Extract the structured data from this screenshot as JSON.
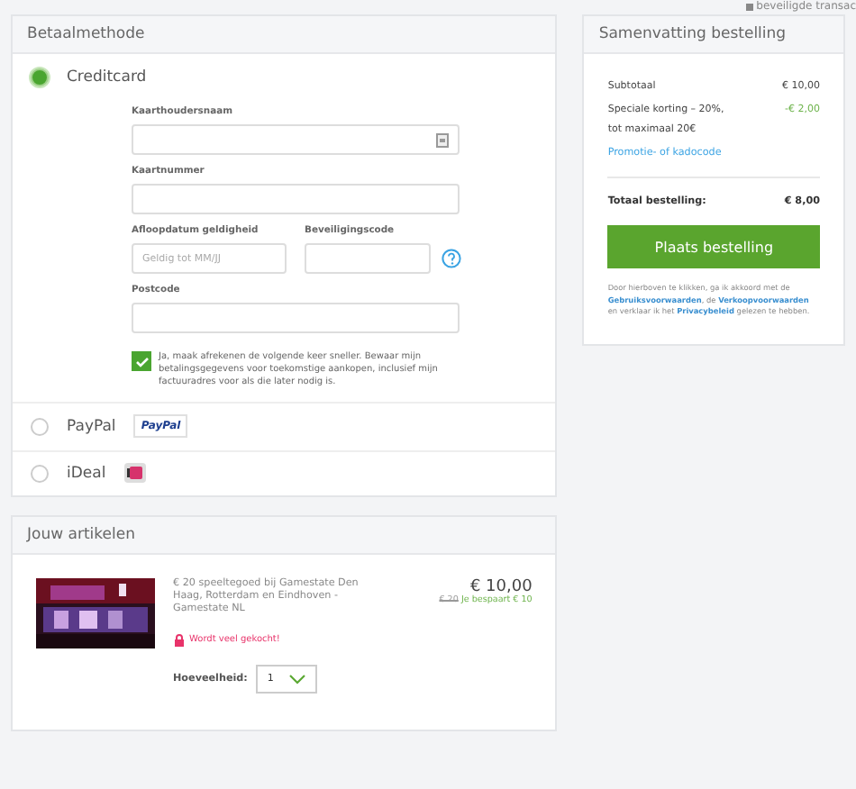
{
  "top_note": "beveiligde transac",
  "payment": {
    "title": "Betaalmethode",
    "methods": [
      {
        "label": "Creditcard",
        "selected": true,
        "kind": "creditcard"
      },
      {
        "label": "PayPal",
        "selected": false,
        "kind": "paypal",
        "logo": "PayPal"
      },
      {
        "label": "iDeal",
        "selected": false,
        "kind": "ideal"
      }
    ],
    "card_form": {
      "holder_label": "Kaarthoudersnaam",
      "number_label": "Kaartnummer",
      "expiry_label": "Afloopdatum geldigheid",
      "expiry_placeholder": "Geldig tot MM/JJ",
      "cvc_label": "Beveiligingscode",
      "postcode_label": "Postcode",
      "save": {
        "checked": true,
        "text": "Ja, maak afrekenen de volgende keer sneller. Bewaar mijn betalingsgegevens voor toekomstige aankopen, inclusief mijn factuuradres voor als die later nodig is."
      }
    }
  },
  "articles": {
    "title": "Jouw artikelen",
    "items": [
      {
        "name": "€ 20 speeltegoed bij Gamestate Den Haag, Rotterdam en Eindhoven - Gamestate NL",
        "price": "€ 10,00",
        "old_price": "€ 20",
        "saving": "Je bespaart € 10",
        "badge": "Wordt veel gekocht!",
        "quantity_label": "Hoeveelheid:",
        "quantity": "1"
      }
    ]
  },
  "summary": {
    "title": "Samenvatting bestelling",
    "lines": [
      {
        "label": "Subtotaal",
        "value": "€ 10,00",
        "kind": "normal"
      },
      {
        "label": "Speciale korting – 20%, tot maximaal 20€",
        "value": "-€ 2,00",
        "kind": "discount"
      }
    ],
    "promo_link": "Promotie- of kadocode",
    "total_label": "Totaal bestelling:",
    "total": "€ 8,00",
    "button": "Plaats bestelling",
    "terms": [
      "Door hierboven te klikken, ga ik akkoord met de ",
      "Gebruiksvoorwaarden",
      ", de ",
      "Verkoopvoorwaarden",
      " en verklaar ik het ",
      "Privacybeleid",
      " gelezen te hebben."
    ]
  }
}
